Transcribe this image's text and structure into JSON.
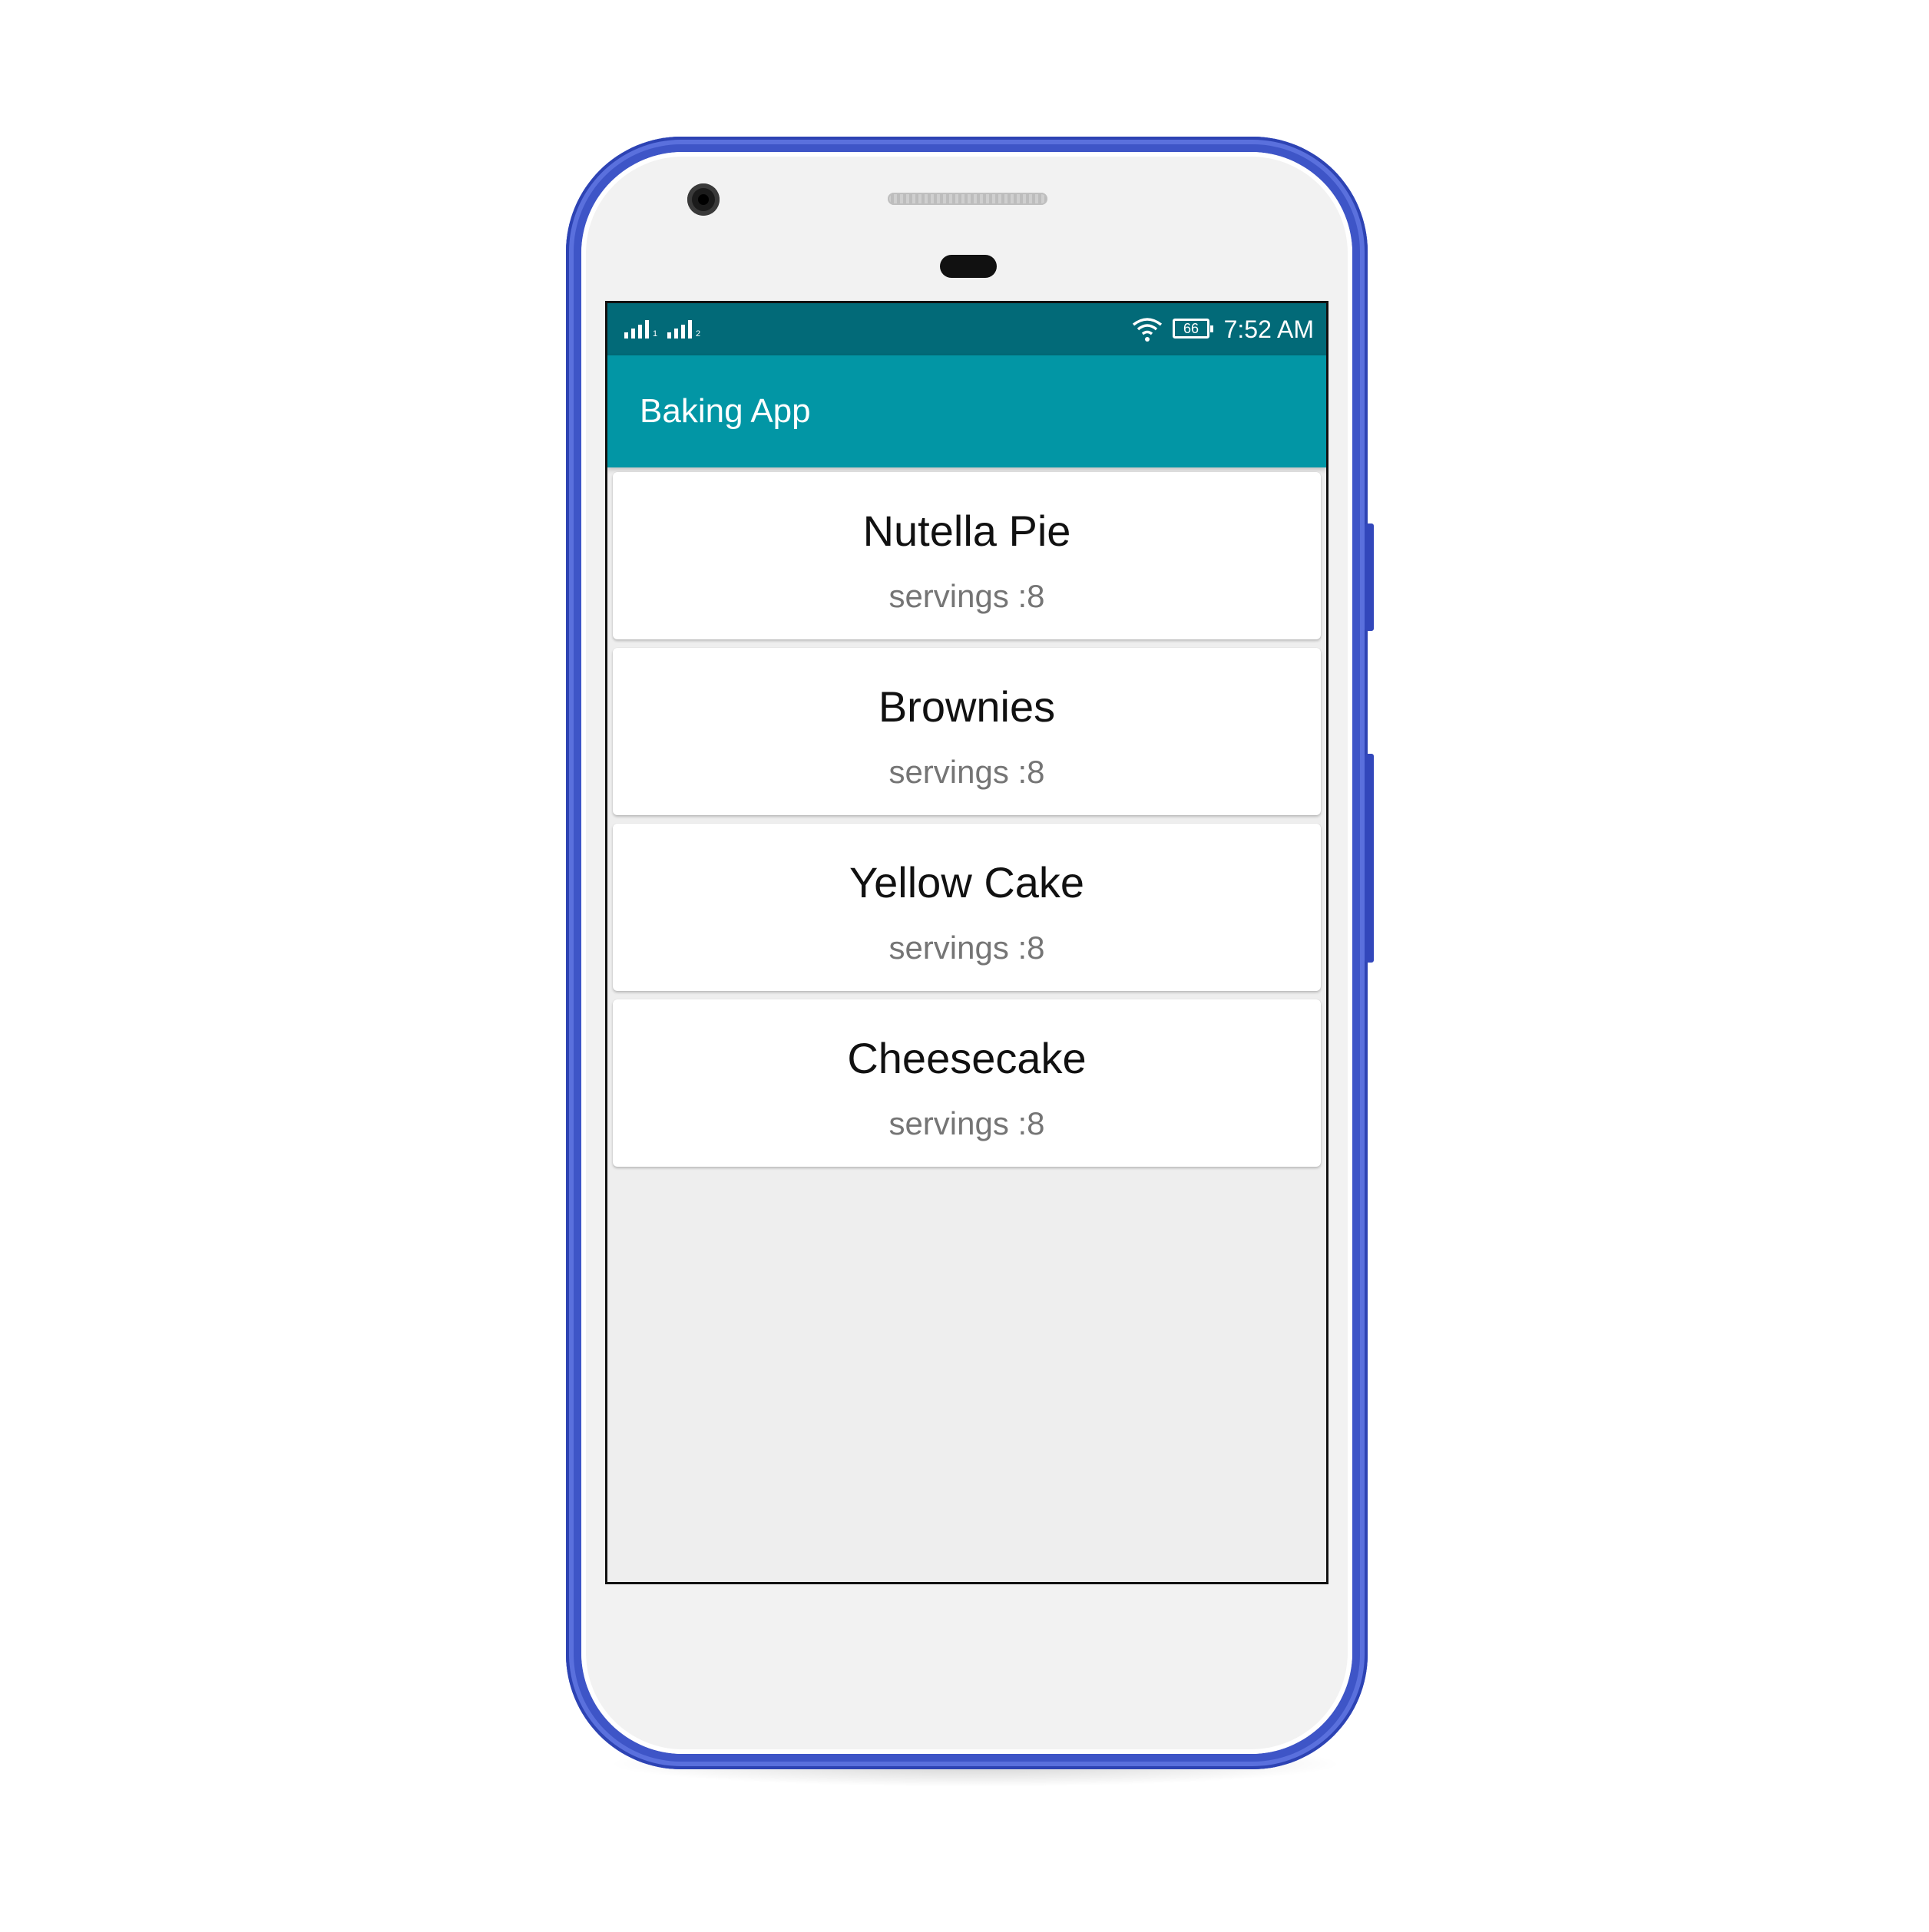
{
  "status_bar": {
    "signal_1_sub": "1",
    "signal_2_sub": "2",
    "wifi_icon": "wifi-icon",
    "battery_level": "66",
    "time": "7:52 AM"
  },
  "app": {
    "title": "Baking App"
  },
  "recipes": [
    {
      "name": "Nutella Pie",
      "servings": "servings :8"
    },
    {
      "name": "Brownies",
      "servings": "servings :8"
    },
    {
      "name": "Yellow Cake",
      "servings": "servings :8"
    },
    {
      "name": "Cheesecake",
      "servings": "servings :8"
    }
  ],
  "colors": {
    "status_bar": "#026a78",
    "toolbar": "#0296a5",
    "phone_frame": "#3e55c7",
    "background": "#eeeeee"
  }
}
